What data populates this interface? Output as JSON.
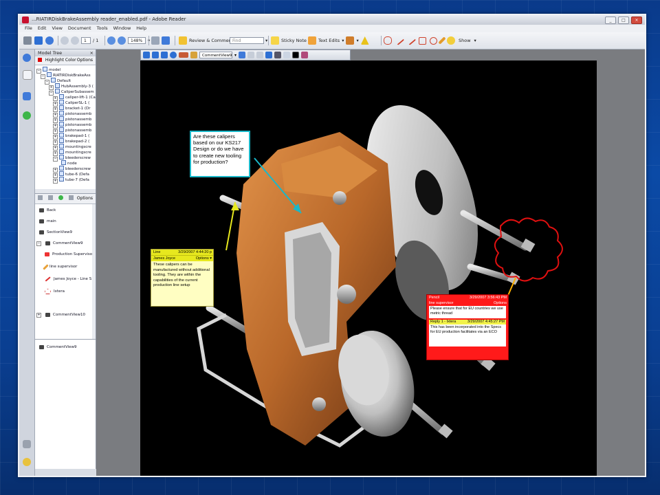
{
  "window": {
    "title": "...RIATIRDiskBrakeAssembly reader_enabled.pdf - Adobe Reader",
    "controls": [
      "_",
      "□",
      "×"
    ]
  },
  "menu": [
    "File",
    "Edit",
    "View",
    "Document",
    "Tools",
    "Window",
    "Help"
  ],
  "toolbar": {
    "page_current": "1",
    "page_total": "/ 1",
    "zoom": "148%",
    "review_comment": "Review & Comment",
    "find_placeholder": "Find",
    "sticky_note": "Sticky Note",
    "text_edits": "Text Edits",
    "show": "Show"
  },
  "toolbar3d": {
    "view_select": "CommentView9"
  },
  "model_tree": {
    "header": "Model Tree",
    "highlight_color": "Highlight Color",
    "options": "Options",
    "items": [
      "model",
      "RIATIRDiskBrakeAss",
      "Default",
      "HubAssembly-3 (",
      "CaliperSubassem",
      "caliper-lift-1 (Ca",
      "CaliperSL-1 (",
      "bracket-1 (Dr",
      "pistonassemb",
      "pistonassemb",
      "pistonassemb",
      "pistonassemb",
      "brakepad-1 (",
      "brakepad-2 (",
      "mountingscre",
      "mountingscre",
      "bleederscrew",
      "node",
      "bleederscrew",
      "tube-6 (Defa",
      "tube-7 (Defa"
    ]
  },
  "views_panel": {
    "options": "Options",
    "items": [
      "Back",
      "main",
      "SectionView9",
      "CommentView9",
      "Production Supervisor",
      "line supervisor",
      "James Joyce - Line S",
      "Ixtera",
      "CommentView10"
    ],
    "bottom_item": "CommentView9"
  },
  "notes": {
    "question": "Are these calipers based on our KS217 Design or do we have to create new tooling for production?",
    "yellow": {
      "type": "Line",
      "date": "3/29/2007 4:44:20 p",
      "author": "James Joyce",
      "options": "Options ▾",
      "text": "These calipers can be manufactured without additional tooling. They are within the capabilities of the current production line setup"
    },
    "red": {
      "type": "Pencil",
      "date": "3/29/2007 3:56:43 PM",
      "author": "line supervisor",
      "options": "Options",
      "text": "Please ensure that for EU countries we use metric thread",
      "reply_label": "Reply 1 - Ixtera",
      "reply_date": "3/29/2007 4:45:27 PM",
      "reply_text": "This has been incorporated into the Specs for EU production facilitates via an ECO"
    }
  },
  "colors": {
    "caliper": "#c9782f",
    "note_cyan": "#19b8c9",
    "note_yellow": "#e7e81e",
    "note_red": "#ff1a1a",
    "background": "#0b4aa6"
  }
}
